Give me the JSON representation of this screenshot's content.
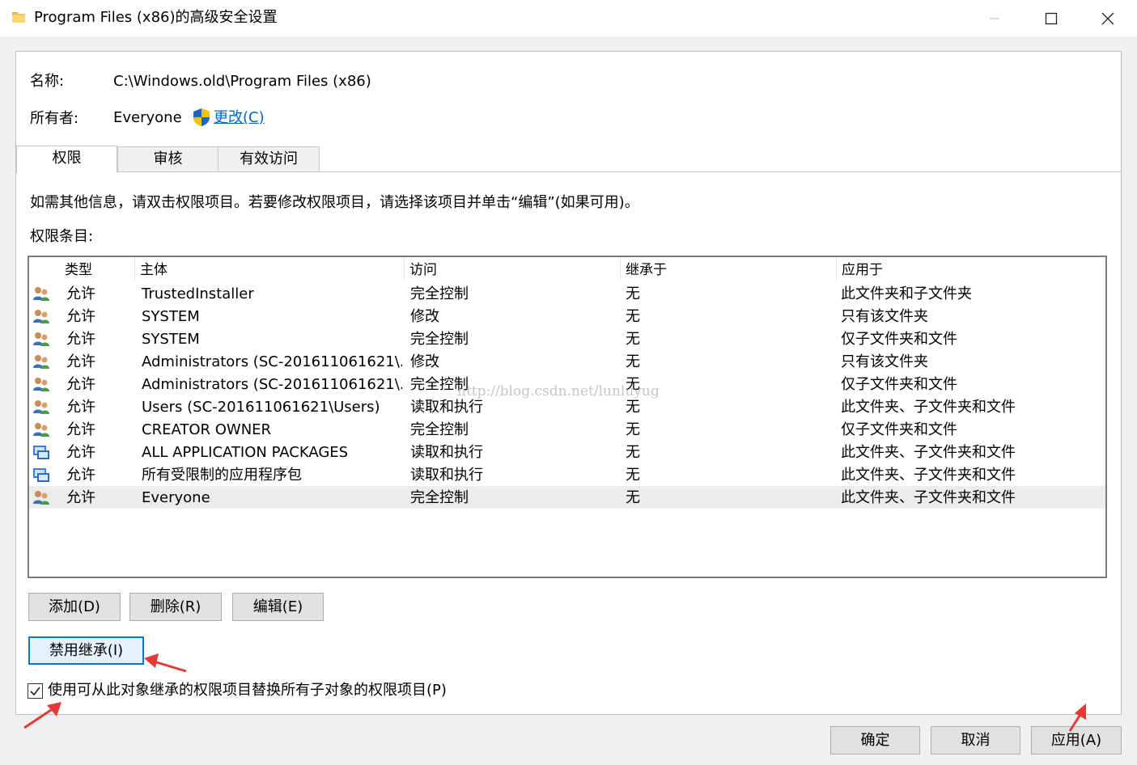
{
  "window": {
    "title": "Program Files (x86)的高级安全设置",
    "icons": {
      "folder": "folder-icon",
      "minimize": "minimize-icon",
      "maximize": "maximize-icon",
      "close": "close-icon"
    }
  },
  "info": {
    "name_label": "名称:",
    "name_value": "C:\\Windows.old\\Program Files (x86)",
    "owner_label": "所有者:",
    "owner_value": "Everyone",
    "change_link": "更改(C)"
  },
  "tabs": [
    {
      "label": "权限",
      "active": true
    },
    {
      "label": "审核",
      "active": false
    },
    {
      "label": "有效访问",
      "active": false
    }
  ],
  "instructions": "如需其他信息，请双击权限项目。若要修改权限项目，请选择该项目并单击“编辑”(如果可用)。",
  "entries_label": "权限条目:",
  "table": {
    "headers": [
      "类型",
      "主体",
      "访问",
      "继承于",
      "应用于"
    ],
    "rows": [
      {
        "icon": "user-group-icon",
        "type": "允许",
        "principal": "TrustedInstaller",
        "access": "完全控制",
        "inherited": "无",
        "applies": "此文件夹和子文件夹"
      },
      {
        "icon": "user-group-icon",
        "type": "允许",
        "principal": "SYSTEM",
        "access": "修改",
        "inherited": "无",
        "applies": "只有该文件夹"
      },
      {
        "icon": "user-group-icon",
        "type": "允许",
        "principal": "SYSTEM",
        "access": "完全控制",
        "inherited": "无",
        "applies": "仅子文件夹和文件"
      },
      {
        "icon": "user-group-icon",
        "type": "允许",
        "principal": "Administrators (SC-201611061621\\...",
        "access": "修改",
        "inherited": "无",
        "applies": "只有该文件夹"
      },
      {
        "icon": "user-group-icon",
        "type": "允许",
        "principal": "Administrators (SC-201611061621\\...",
        "access": "完全控制",
        "inherited": "无",
        "applies": "仅子文件夹和文件"
      },
      {
        "icon": "user-group-icon",
        "type": "允许",
        "principal": "Users (SC-201611061621\\Users)",
        "access": "读取和执行",
        "inherited": "无",
        "applies": "此文件夹、子文件夹和文件"
      },
      {
        "icon": "user-group-icon",
        "type": "允许",
        "principal": "CREATOR OWNER",
        "access": "完全控制",
        "inherited": "无",
        "applies": "仅子文件夹和文件"
      },
      {
        "icon": "app-package-icon",
        "type": "允许",
        "principal": "ALL APPLICATION PACKAGES",
        "access": "读取和执行",
        "inherited": "无",
        "applies": "此文件夹、子文件夹和文件"
      },
      {
        "icon": "app-package-icon",
        "type": "允许",
        "principal": "所有受限制的应用程序包",
        "access": "读取和执行",
        "inherited": "无",
        "applies": "此文件夹、子文件夹和文件"
      },
      {
        "icon": "user-group-icon",
        "type": "允许",
        "principal": "Everyone",
        "access": "完全控制",
        "inherited": "无",
        "applies": "此文件夹、子文件夹和文件",
        "selected": true
      }
    ]
  },
  "buttons": {
    "add": "添加(D)",
    "remove": "删除(R)",
    "edit": "编辑(E)",
    "disable_inheritance": "禁用继承(I)",
    "ok": "确定",
    "cancel": "取消",
    "apply": "应用(A)"
  },
  "replace_checkbox": {
    "label": "使用可从此对象继承的权限项目替换所有子对象的权限项目(P)",
    "checked": true
  },
  "watermark": "http://blog.csdn.net/lunluyug",
  "colors": {
    "accent": "#0078d7",
    "link": "#0066cc",
    "annotation_arrow": "#e53935"
  }
}
